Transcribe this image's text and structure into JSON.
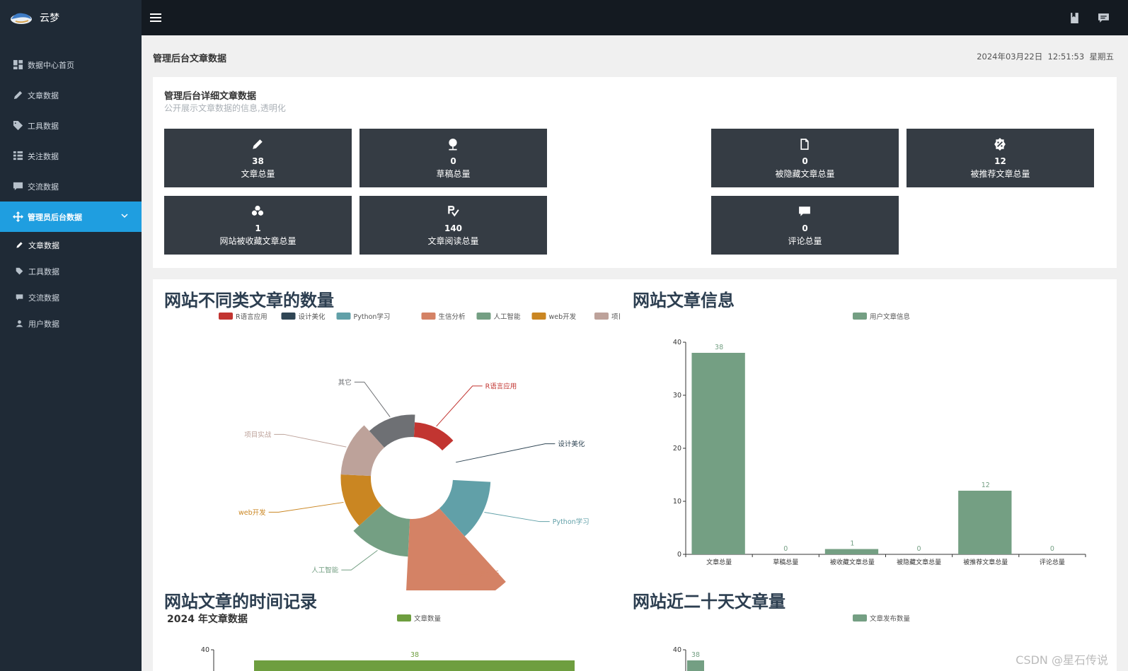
{
  "app": {
    "brand": "云梦"
  },
  "sidebar": {
    "items": [
      {
        "label": "数据中心首页",
        "icon": "dashboard-icon"
      },
      {
        "label": "文章数据",
        "icon": "pencil-icon"
      },
      {
        "label": "工具数据",
        "icon": "tag-icon"
      },
      {
        "label": "关注数据",
        "icon": "grid-icon"
      },
      {
        "label": "交流数据",
        "icon": "comment-icon"
      }
    ],
    "active": {
      "label": "管理员后台数据",
      "icon": "move-icon"
    },
    "sub_items": [
      {
        "label": "文章数据",
        "icon": "pencil-icon"
      },
      {
        "label": "工具数据",
        "icon": "tag-icon"
      },
      {
        "label": "交流数据",
        "icon": "comment-icon"
      },
      {
        "label": "用户数据",
        "icon": "user-icon"
      }
    ]
  },
  "header": {
    "title": "管理后台文章数据",
    "datetime": "2024年03月22日  12:51:53  星期五"
  },
  "summary": {
    "title": "管理后台详细文章数据",
    "subtitle": "公开展示文章数据的信息,透明化",
    "cards": [
      {
        "value": "38",
        "label": "文章总量",
        "icon": "pencil-icon"
      },
      {
        "value": "0",
        "label": "草稿总量",
        "icon": "pin-icon"
      },
      {
        "value": "0",
        "label": "被隐藏文章总量",
        "icon": "file-icon"
      },
      {
        "value": "12",
        "label": "被推荐文章总量",
        "icon": "badge-icon"
      },
      {
        "value": "1",
        "label": "网站被收藏文章总量",
        "icon": "fan-icon"
      },
      {
        "value": "140",
        "label": "文章阅读总量",
        "icon": "rx-icon"
      },
      {
        "value": "0",
        "label": "评论总量",
        "icon": "comment-icon"
      }
    ]
  },
  "charts_titles": {
    "pie": "网站不同类文章的数量",
    "bar": "网站文章信息",
    "timeline": "网站文章的时间记录",
    "recent": "网站近二十天文章量"
  },
  "watermark": "CSDN @星石传说",
  "chart_data": [
    {
      "type": "pie",
      "title": "网站不同类文章的数量",
      "series": [
        {
          "name": "R语言应用",
          "value": 1,
          "color": "#c23531"
        },
        {
          "name": "设计美化",
          "value": 0,
          "color": "#2f4554"
        },
        {
          "name": "Python学习",
          "value": 4,
          "color": "#61a0a8"
        },
        {
          "name": "生信分析",
          "value": 12,
          "color": "#d48265"
        },
        {
          "name": "人工智能",
          "value": 4,
          "color": "#749f83"
        },
        {
          "name": "web开发",
          "value": 3,
          "color": "#ca8622"
        },
        {
          "name": "项目实战",
          "value": 3,
          "color": "#bda29a"
        },
        {
          "name": "其它",
          "value": 2,
          "color": "#6e7074"
        }
      ]
    },
    {
      "type": "bar",
      "title": "网站文章信息",
      "legend": "用户文章信息",
      "categories": [
        "文章总量",
        "草稿总量",
        "被收藏文章总量",
        "被隐藏文章总量",
        "被推荐文章总量",
        "评论总量"
      ],
      "values": [
        38,
        0,
        1,
        0,
        12,
        0
      ],
      "ylim": [
        0,
        40
      ],
      "yticks": [
        0,
        10,
        20,
        30,
        40
      ],
      "color": "#749f83"
    },
    {
      "type": "bar",
      "title": "网站文章的时间记录",
      "subtitle": "2024 年文章数据",
      "legend": "文章数量",
      "values": [
        38
      ],
      "ylim": [
        0,
        40
      ],
      "yticks": [
        40
      ],
      "color": "#6e9e3f"
    },
    {
      "type": "bar",
      "title": "网站近二十天文章量",
      "legend": "文章发布数量",
      "values": [
        38
      ],
      "ylim": [
        0,
        40
      ],
      "yticks": [
        40
      ],
      "color": "#749f83"
    }
  ]
}
